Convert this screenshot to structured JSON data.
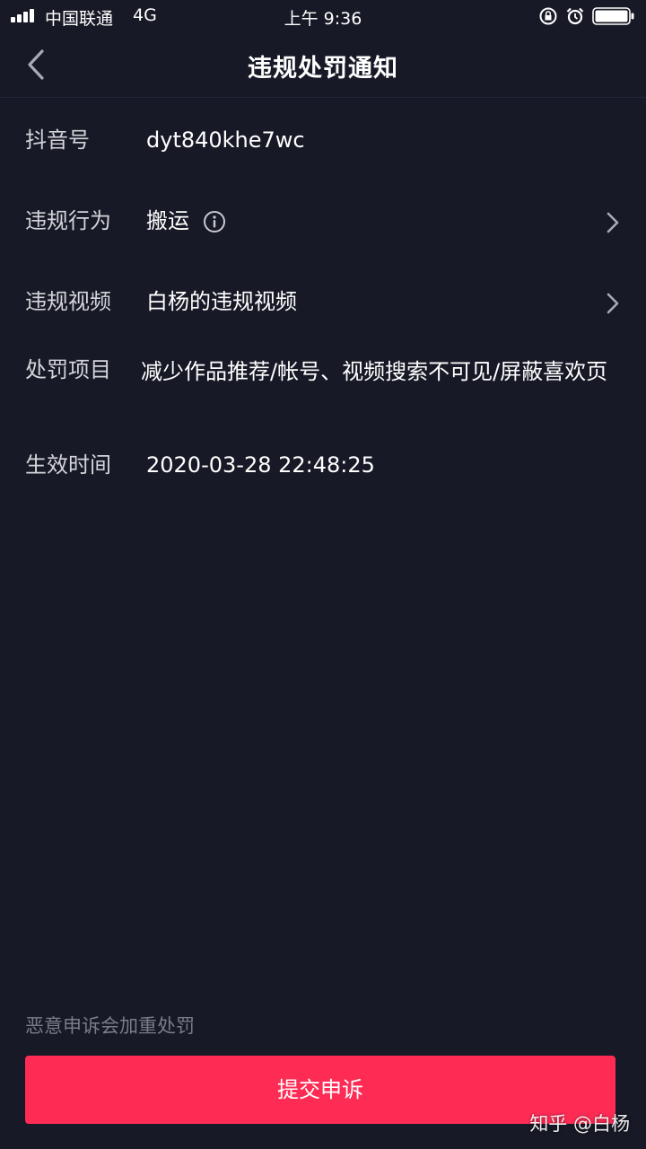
{
  "status_bar": {
    "carrier": "中国联通",
    "network": "4G",
    "time": "上午 9:36"
  },
  "header": {
    "title": "违规处罚通知"
  },
  "rows": {
    "account": {
      "label": "抖音号",
      "value": "dyt840khe7wc"
    },
    "behavior": {
      "label": "违规行为",
      "value": "搬运"
    },
    "video": {
      "label": "违规视频",
      "value": "白杨的违规视频"
    },
    "punishment": {
      "label": "处罚项目",
      "value": "减少作品推荐/帐号、视频搜索不可见/屏蔽喜欢页"
    },
    "effective_time": {
      "label": "生效时间",
      "value": "2020-03-28 22:48:25"
    }
  },
  "footer": {
    "warning": "恶意申诉会加重处罚",
    "submit_label": "提交申诉",
    "watermark": "知乎 @白杨"
  },
  "colors": {
    "background": "#171926",
    "accent": "#fe2c55"
  }
}
